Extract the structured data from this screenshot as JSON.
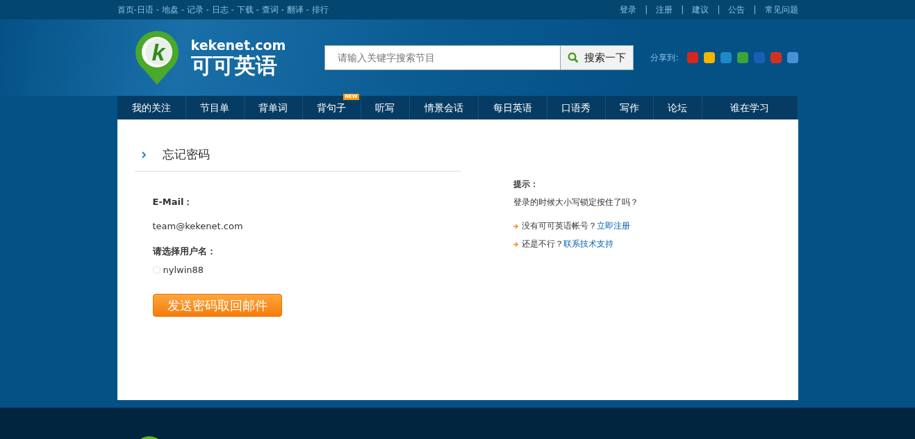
{
  "top_bar": {
    "left_links": [
      "首页",
      "日语",
      "地盘",
      "记录",
      "日志",
      "下载",
      "查词",
      "翻译",
      "排行"
    ],
    "left_first_separator": "-",
    "left_separator": " - ",
    "right_links": [
      "登录",
      "注册",
      "建议",
      "公告",
      "常见问题"
    ],
    "right_separator": "|"
  },
  "logo": {
    "domain": "kekenet.com",
    "name": "可可英语",
    "letter": "k"
  },
  "search": {
    "placeholder": "请输入关键字搜索节目",
    "button": "搜索一下"
  },
  "share": {
    "label": "分享到:",
    "icons": [
      {
        "color": "#d9261c"
      },
      {
        "color": "#f5b400"
      },
      {
        "color": "#1e88c8"
      },
      {
        "color": "#3aa63a"
      },
      {
        "color": "#1a5fb4"
      },
      {
        "color": "#d4301f"
      },
      {
        "color": "#4a90d9"
      }
    ]
  },
  "nav": [
    {
      "label": "我的关注"
    },
    {
      "label": "节目单"
    },
    {
      "label": "背单词"
    },
    {
      "label": "背句子",
      "badge": "NEW"
    },
    {
      "label": "听写"
    },
    {
      "label": "情景会话"
    },
    {
      "label": "每日英语"
    },
    {
      "label": "口语秀"
    },
    {
      "label": "写作"
    },
    {
      "label": "论坛"
    },
    {
      "label": "谁在学习"
    }
  ],
  "page": {
    "title": "忘记密码",
    "form": {
      "email_label": "E-Mail：",
      "email_value": "team@kekenet.com",
      "user_label": "请选择用户名：",
      "users": [
        {
          "name": "nylwin88",
          "selected": false
        }
      ],
      "submit": "发送密码取回邮件"
    },
    "tips": {
      "heading": "提示：",
      "text": "登录的时候大小写锁定按住了吗？",
      "links": [
        {
          "text": "没有可可英语帐号？",
          "link": "立即注册"
        },
        {
          "text": "还是不行？",
          "link": "联系技术支持"
        }
      ]
    }
  }
}
